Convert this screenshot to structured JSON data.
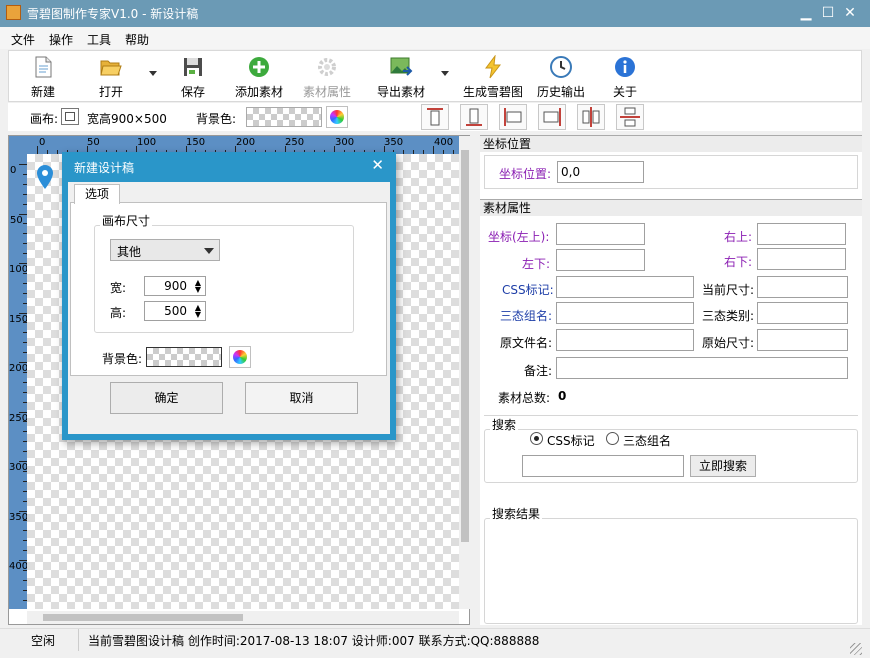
{
  "window": {
    "title": "雪碧图制作专家V1.0 - 新设计稿",
    "minimize": "▁",
    "maximize": "☐",
    "close": "✕"
  },
  "menu": [
    "文件",
    "操作",
    "工具",
    "帮助"
  ],
  "toolbar": {
    "new": "新建",
    "open": "打开",
    "save": "保存",
    "add_material": "添加素材",
    "material_props": "素材属性",
    "export_material": "导出素材",
    "generate_sprite": "生成雪碧图",
    "history_output": "历史输出",
    "about": "关于"
  },
  "canvasbar": {
    "canvas_label": "画布:",
    "size_text": "宽高900×500",
    "bg_label": "背景色:"
  },
  "ruler": {
    "top": [
      "0",
      "50",
      "100",
      "150",
      "200",
      "250",
      "300",
      "350",
      "400"
    ],
    "left": [
      "0",
      "50",
      "100",
      "150",
      "200",
      "250",
      "300",
      "350",
      "400"
    ]
  },
  "coord": {
    "section": "坐标位置",
    "label": "坐标位置:",
    "value": "0,0"
  },
  "material": {
    "section": "素材属性",
    "left_top": "坐标(左上):",
    "right_top": "右上:",
    "left_bottom": "左下:",
    "right_bottom": "右下:",
    "css_tag": "CSS标记:",
    "current_size": "当前尺寸:",
    "tristate_group": "三态组名:",
    "tristate_type": "三态类别:",
    "orig_file": "原文件名:",
    "orig_size": "原始尺寸:",
    "note": "备注:",
    "total_label": "素材总数:",
    "total_value": "0"
  },
  "search": {
    "group": "搜索",
    "opt_css": "CSS标记",
    "opt_tristate": "三态组名",
    "button": "立即搜索",
    "results_group": "搜索结果"
  },
  "status": {
    "state": "空闲",
    "info": "当前雪碧图设计稿 创作时间:2017-08-13 18:07 设计师:007 联系方式:QQ:888888"
  },
  "dialog": {
    "title": "新建设计稿",
    "close": "✕",
    "tab": "选项",
    "group": "画布尺寸",
    "preset": "其他",
    "width_label": "宽:",
    "width_value": "900",
    "height_label": "高:",
    "height_value": "500",
    "bg_label": "背景色:",
    "ok": "确定",
    "cancel": "取消"
  }
}
